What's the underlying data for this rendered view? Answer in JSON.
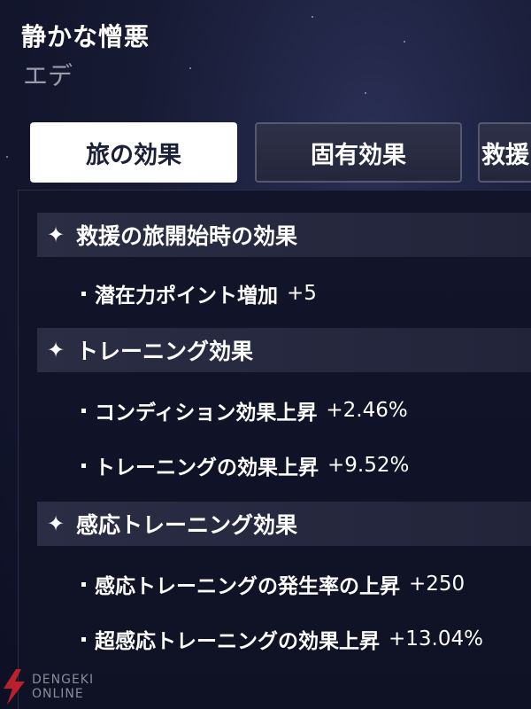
{
  "header": {
    "title": "静かな憎悪",
    "subtitle": "エデ"
  },
  "tabs": [
    {
      "label": "旅の効果",
      "active": true
    },
    {
      "label": "固有効果",
      "active": false
    },
    {
      "label": "救援",
      "active": false
    }
  ],
  "sections": [
    {
      "title": "救援の旅開始時の効果",
      "items": [
        {
          "name": "潜在力ポイント増加",
          "value": "+5"
        }
      ]
    },
    {
      "title": "トレーニング効果",
      "items": [
        {
          "name": "コンディション効果上昇",
          "value": "+2.46%"
        },
        {
          "name": "トレーニングの効果上昇",
          "value": "+9.52%"
        }
      ]
    },
    {
      "title": "感応トレーニング効果",
      "items": [
        {
          "name": "感応トレーニングの発生率の上昇",
          "value": "+250"
        },
        {
          "name": "超感応トレーニングの効果上昇",
          "value": "+13.04%"
        }
      ]
    }
  ],
  "watermark": {
    "line1": "DENGEKI",
    "line2": "ONLINE"
  },
  "colors": {
    "background": "#161a33",
    "tab_active_bg": "#ffffff",
    "tab_active_text": "#1c1f38",
    "tab_inactive_bg": "#2e3148",
    "section_header_bg": "#2a2d44",
    "subtitle": "#9a9cab",
    "logo_red": "#d9232d"
  }
}
